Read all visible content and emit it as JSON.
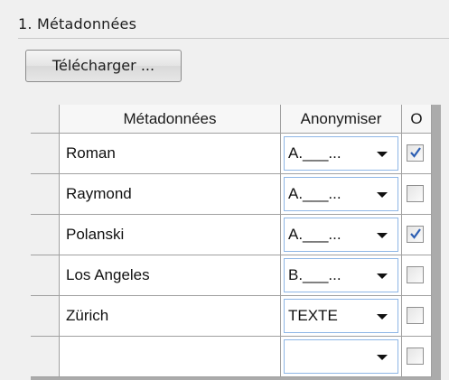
{
  "section": {
    "title": "1. Métadonnées"
  },
  "upload_button": {
    "label": "Télécharger ..."
  },
  "grid": {
    "columns": [
      "Métadonnées",
      "Anonymiser",
      "O"
    ],
    "rows": [
      {
        "metadata": "Roman",
        "anonymize": "A.___...",
        "checked": true
      },
      {
        "metadata": "Raymond",
        "anonymize": "A.___...",
        "checked": false
      },
      {
        "metadata": "Polanski",
        "anonymize": "A.___...",
        "checked": true
      },
      {
        "metadata": "Los Angeles",
        "anonymize": "B.___...",
        "checked": false
      },
      {
        "metadata": "Zürich",
        "anonymize": "TEXTE",
        "checked": false
      },
      {
        "metadata": "",
        "anonymize": "",
        "checked": false
      }
    ]
  },
  "colors": {
    "check_mark": "#2d5fb3",
    "combo_border": "#8eb6e6"
  }
}
